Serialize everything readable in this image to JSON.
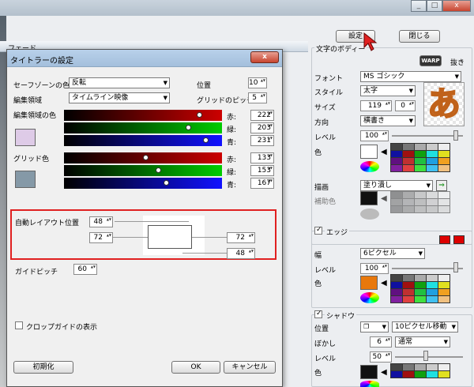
{
  "window": {
    "minimize": "_",
    "maximize": "□",
    "close": "x"
  },
  "right": {
    "settings_btn": "設定",
    "close_btn": "閉じる",
    "body_group": "文字のボディー",
    "warp": "WARP",
    "nuki": "抜き",
    "font_label": "フォント",
    "font_value": "MS ゴシック",
    "style_label": "スタイル",
    "style_value": "太字",
    "size_label": "サイズ",
    "size_value": "119",
    "size_value2": "0",
    "direction_label": "方向",
    "direction_value": "横書き",
    "level_label": "レベル",
    "level_value": "100",
    "color_label": "色",
    "preview_char": "あ",
    "draw_label": "描画",
    "draw_value": "塗り潰し",
    "aux_label": "補助色",
    "edge_label": "エッジ",
    "width_label": "幅",
    "width_value": "6ピクセル",
    "edge_level_label": "レベル",
    "edge_level_value": "100",
    "edge_color_label": "色",
    "shadow_label": "シャドウ",
    "pos_label": "位置",
    "pos_value": "10ピクセル移動",
    "blur_label": "ぼかし",
    "blur_value": "6",
    "blur_mode": "通常",
    "shadow_level_label": "レベル",
    "shadow_level_value": "50",
    "shadow_color_label": "色"
  },
  "dialog": {
    "title": "タイトラーの設定",
    "close": "x",
    "safe_label": "セーフゾーンの色",
    "safe_value": "反転",
    "pos_label": "位置",
    "pos_value": "10",
    "edit_area_label": "編集領域",
    "edit_area_value": "タイムライン映像",
    "grid_pitch_label": "グリッドのピッチ",
    "grid_pitch_value": "5",
    "edit_color_label": "編集領域の色",
    "r_label": "赤:",
    "g_label": "緑:",
    "b_label": "青:",
    "edit_r": "222",
    "edit_g": "203",
    "edit_b": "231",
    "grid_color_label": "グリッド色",
    "grid_r": "133",
    "grid_g": "153",
    "grid_b": "167",
    "auto_layout_label": "自動レイアウト位置",
    "top": "48",
    "left": "72",
    "right": "72",
    "bottom": "48",
    "guide_pitch_label": "ガイドピッチ",
    "guide_pitch_value": "60",
    "crop_label": "クロップガイドの表示",
    "reset_btn": "初期化",
    "ok_btn": "OK",
    "cancel_btn": "キャンセル"
  },
  "background": {
    "tab_label": "フェード"
  },
  "colors": {
    "edit_swatch": "#decbe7",
    "grid_swatch": "#8599a7",
    "highlight": "#e02020",
    "accent_arrow": "#e02020"
  }
}
